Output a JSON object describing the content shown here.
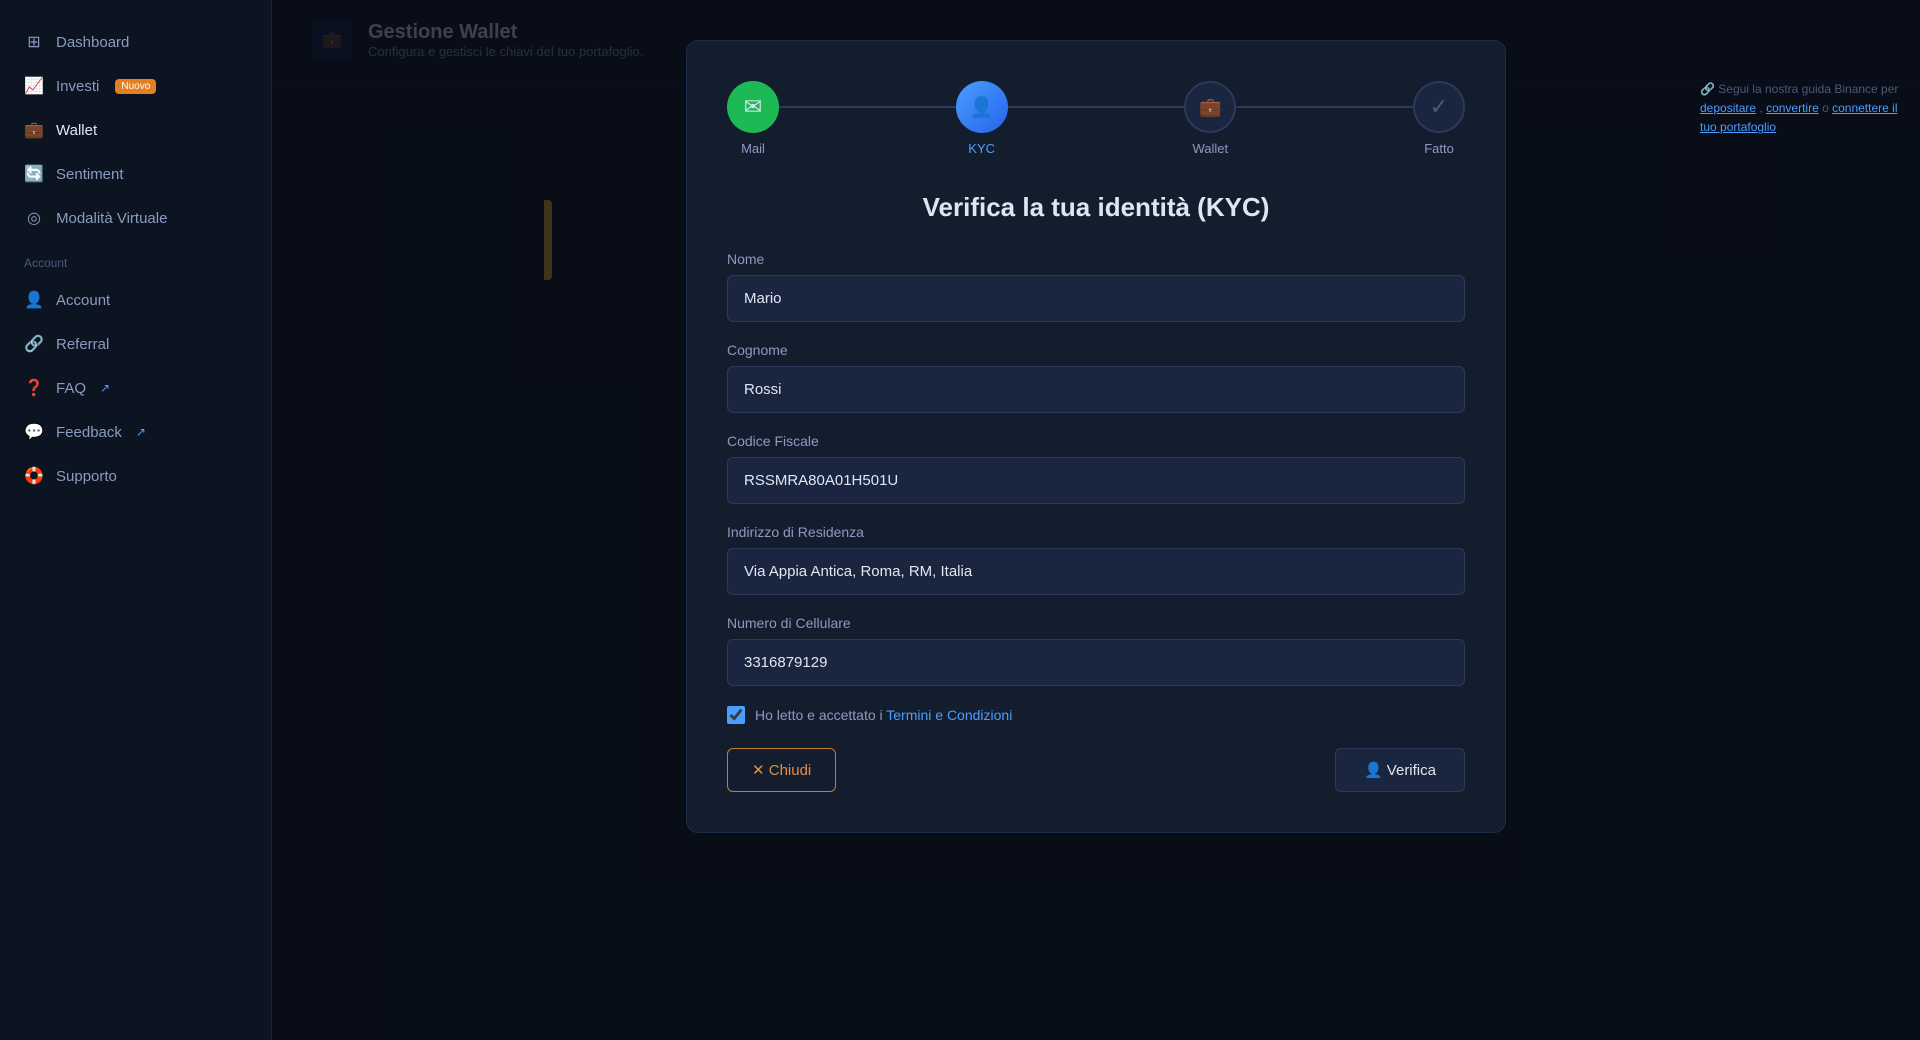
{
  "sidebar": {
    "section_main": "",
    "items": [
      {
        "id": "dashboard",
        "label": "Dashboard",
        "icon": "⊞"
      },
      {
        "id": "investi",
        "label": "Investi",
        "icon": "📈",
        "badge": "Nuovo"
      },
      {
        "id": "wallet",
        "label": "Wallet",
        "icon": "💼"
      },
      {
        "id": "sentiment",
        "label": "Sentiment",
        "icon": "🔄"
      },
      {
        "id": "modalita-virtuale",
        "label": "Modalità Virtuale",
        "icon": "◎"
      }
    ],
    "section_account": "Account",
    "account_items": [
      {
        "id": "account",
        "label": "Account",
        "icon": "👤"
      },
      {
        "id": "referral",
        "label": "Referral",
        "icon": "🔗"
      },
      {
        "id": "faq",
        "label": "FAQ",
        "icon": "❓"
      },
      {
        "id": "feedback",
        "label": "Feedback",
        "icon": "💬"
      },
      {
        "id": "supporto",
        "label": "Supporto",
        "icon": "🛟"
      }
    ]
  },
  "page": {
    "icon": "💼",
    "title": "Gestione Wallet",
    "subtitle": "Configura e gestisci le chiavi del tuo portafoglio."
  },
  "stepper": {
    "steps": [
      {
        "id": "mail",
        "label": "Mail",
        "state": "completed",
        "icon": "✉"
      },
      {
        "id": "kyc",
        "label": "KYC",
        "state": "active",
        "icon": "👤"
      },
      {
        "id": "wallet",
        "label": "Wallet",
        "state": "inactive",
        "icon": "💼"
      },
      {
        "id": "fatto",
        "label": "Fatto",
        "state": "inactive",
        "icon": "✓"
      }
    ]
  },
  "modal": {
    "title": "Verifica la tua identità (KYC)",
    "fields": {
      "nome": {
        "label": "Nome",
        "value": "Mario",
        "placeholder": "Nome"
      },
      "cognome": {
        "label": "Cognome",
        "value": "Rossi",
        "placeholder": "Cognome"
      },
      "codice_fiscale": {
        "label": "Codice Fiscale",
        "value": "RSSMRA80A01H501U",
        "placeholder": "Codice Fiscale"
      },
      "indirizzo": {
        "label": "Indirizzo di Residenza",
        "value": "Via Appia Antica, Roma, RM, Italia",
        "placeholder": "Indirizzo di Residenza"
      },
      "cellulare": {
        "label": "Numero di Cellulare",
        "value": "3316879129",
        "placeholder": "Numero di Cellulare"
      }
    },
    "checkbox_text": "Ho letto e accettato i ",
    "checkbox_link": "Termini e Condizioni",
    "checkbox_checked": true,
    "btn_close": "✕ Chiudi",
    "btn_verify": "👤 Verifica"
  },
  "right_hint": {
    "text": "Segui la nostra guida Binance per ",
    "link1": "depositare",
    "text2": ", ",
    "link2": "convertire",
    "text3": " o ",
    "link3": "connettere il tuo portafoglio"
  }
}
